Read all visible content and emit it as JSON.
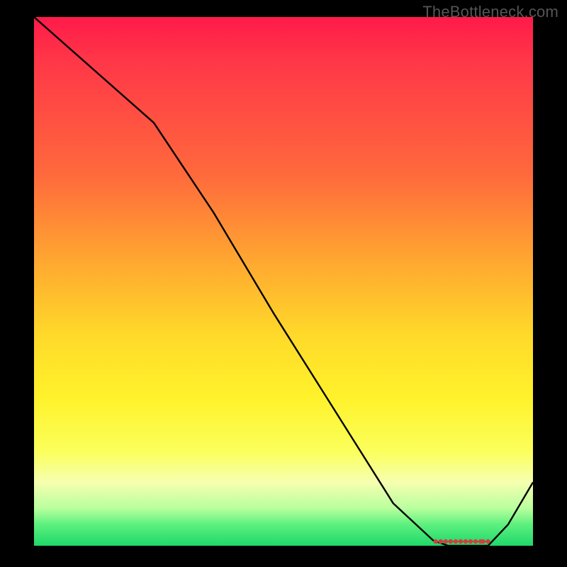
{
  "watermark": "TheBottleneck.com",
  "chart_data": {
    "type": "line",
    "title": "",
    "xlabel": "",
    "ylabel": "",
    "xlim": [
      0,
      100
    ],
    "ylim": [
      0,
      100
    ],
    "background": {
      "gradient_top_color": "#ff1a49",
      "gradient_bottom_color": "#1fd86a",
      "meaning": "vertical red-to-green heat gradient; red = high bottleneck %, green = optimal"
    },
    "series": [
      {
        "name": "bottleneck-curve",
        "color": "#000000",
        "x": [
          0,
          12,
          24,
          36,
          48,
          60,
          72,
          80,
          83,
          85,
          86,
          88,
          89,
          91,
          95,
          100
        ],
        "y": [
          100,
          90,
          80,
          63,
          44,
          26,
          8,
          1,
          0,
          0,
          0,
          0,
          0,
          0,
          4,
          12
        ]
      }
    ],
    "optimal_region_markers": {
      "color": "#d04040",
      "x": [
        80.5,
        81.5,
        82.5,
        83.5,
        84.5,
        85.5,
        86.5,
        87.5,
        88.5,
        89.5,
        90.0,
        91.0
      ],
      "y": 0.8
    }
  }
}
